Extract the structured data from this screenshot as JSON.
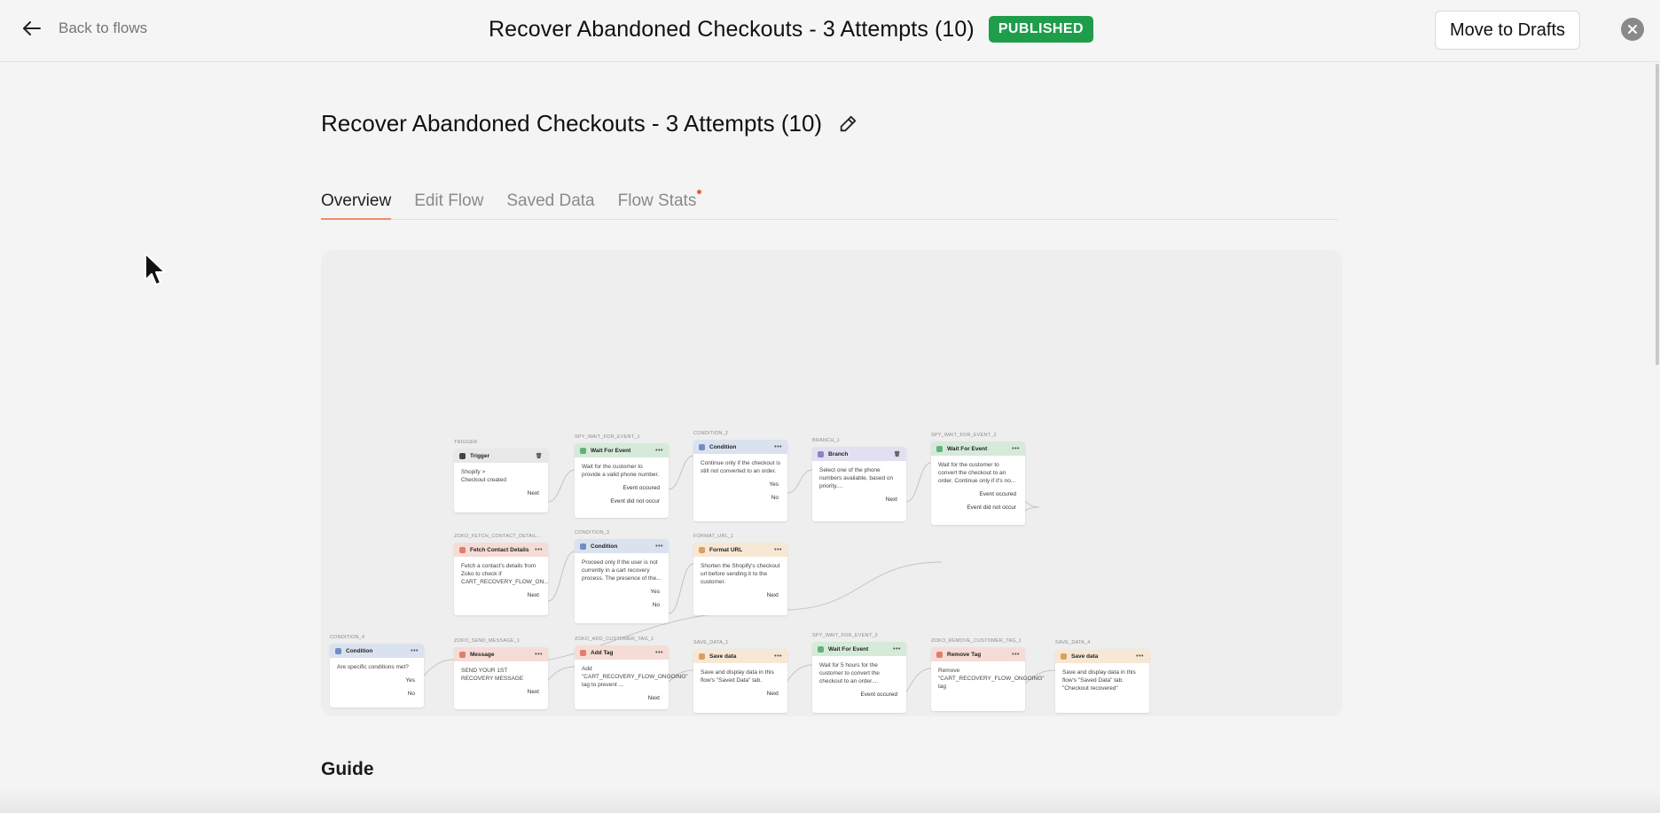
{
  "header": {
    "back_label": "Back to flows",
    "title": "Recover Abandoned Checkouts - 3 Attempts (10)",
    "status_badge": "PUBLISHED",
    "move_to_drafts": "Move to Drafts"
  },
  "page": {
    "title": "Recover Abandoned Checkouts - 3 Attempts (10)",
    "tabs": [
      "Overview",
      "Edit Flow",
      "Saved Data",
      "Flow Stats"
    ],
    "active_tab": "Overview",
    "guide_heading": "Guide"
  },
  "flow": {
    "nodes": [
      {
        "id": "n1",
        "label": "TRIGGER",
        "title": "Trigger",
        "body": "Shopify >\nCheckout created",
        "outputs": [
          "Next"
        ],
        "color": "grey",
        "icon": "shopify-icon",
        "has_delete": true
      },
      {
        "id": "n2",
        "label": "SPY_WAIT_FOR_EVENT_1",
        "title": "Wait For Event",
        "body": "Wait for the customer to provide a valid phone number.",
        "outputs": [
          "Event occured",
          "Event did not occur"
        ],
        "color": "green",
        "icon": "clock-icon"
      },
      {
        "id": "n3",
        "label": "CONDITION_2",
        "title": "Condition",
        "body": "Continue only if the checkout is still not converted to an order.",
        "outputs": [
          "Yes",
          "No"
        ],
        "color": "blue",
        "icon": "filter-icon"
      },
      {
        "id": "n4",
        "label": "BRANCH_1",
        "title": "Branch",
        "body": "Select one of the phone numbers available, based on priority....",
        "outputs": [
          "Next"
        ],
        "color": "purple",
        "icon": "branch-icon",
        "has_delete": true
      },
      {
        "id": "n5",
        "label": "SPY_WAIT_FOR_EVENT_2",
        "title": "Wait For Event",
        "body": "Wait for the customer to convert the checkout to an order. Continue only if it's no...",
        "outputs": [
          "Event occured",
          "Event did not occur"
        ],
        "color": "green",
        "icon": "clock-icon"
      },
      {
        "id": "n6",
        "label": "ZOKO_FETCH_CONTACT_DETAIL...",
        "title": "Fetch Contact Details",
        "body": "Fetch a contact's details from Zoko to check if CART_RECOVERY_FLOW_ON...",
        "outputs": [
          "Next"
        ],
        "color": "red",
        "icon": "person-icon"
      },
      {
        "id": "n7",
        "label": "CONDITION_3",
        "title": "Condition",
        "body": "Proceed only if the user is not currently in a cart recovery process. The presence of the...",
        "outputs": [
          "Yes",
          "No"
        ],
        "color": "blue",
        "icon": "filter-icon"
      },
      {
        "id": "n8",
        "label": "FORMAT_URL_1",
        "title": "Format URL",
        "body": "Shorten the Shopify's checkout url before sending it to the customer.",
        "outputs": [
          "Next"
        ],
        "color": "orange",
        "icon": "link-icon"
      },
      {
        "id": "n9",
        "label": "CONDITION_4",
        "title": "Condition",
        "body": "Are specific conditions met?",
        "outputs": [
          "Yes",
          "No"
        ],
        "color": "blue",
        "icon": "filter-icon"
      },
      {
        "id": "n10",
        "label": "ZOKO_SEND_MESSAGE_1",
        "title": "Message",
        "body": "SEND YOUR 1ST RECOVERY MESSAGE",
        "outputs": [
          "Next"
        ],
        "color": "red",
        "icon": "message-icon"
      },
      {
        "id": "n11",
        "label": "ZOKO_ADD_CUSTOMER_TAG_1",
        "title": "Add Tag",
        "body": "Add \"CART_RECOVERY_FLOW_ONGOING\" tag to prevent ...",
        "outputs": [
          "Next"
        ],
        "color": "red",
        "icon": "tag-icon"
      },
      {
        "id": "n12",
        "label": "SAVE_DATA_1",
        "title": "Save data",
        "body": "Save and display data in this flow's \"Saved Data\" tab.",
        "outputs": [
          "Next"
        ],
        "color": "orange",
        "icon": "save-icon"
      },
      {
        "id": "n13",
        "label": "SPY_WAIT_FOR_EVENT_3",
        "title": "Wait For Event",
        "body": "Wait for 5 hours for the customer to convert the checkout to an order....",
        "outputs": [
          "Event occured"
        ],
        "color": "green",
        "icon": "clock-icon"
      },
      {
        "id": "n14",
        "label": "ZOKO_REMOVE_CUSTOMER_TAG_1",
        "title": "Remove Tag",
        "body": "Remove \"CART_RECOVERY_FLOW_ONGOING\" tag",
        "outputs": [],
        "color": "red",
        "icon": "tag-icon"
      },
      {
        "id": "n15",
        "label": "SAVE_DATA_4",
        "title": "Save data",
        "body": "Save and display data in this flow's \"Saved Data\" tab. \"Checkout recovered\"",
        "outputs": [],
        "color": "orange",
        "icon": "save-icon"
      }
    ]
  },
  "colors": {
    "published": "#1e9d4a",
    "tab_underline": "#f08c6a",
    "notification_dot": "#f05a3a"
  }
}
